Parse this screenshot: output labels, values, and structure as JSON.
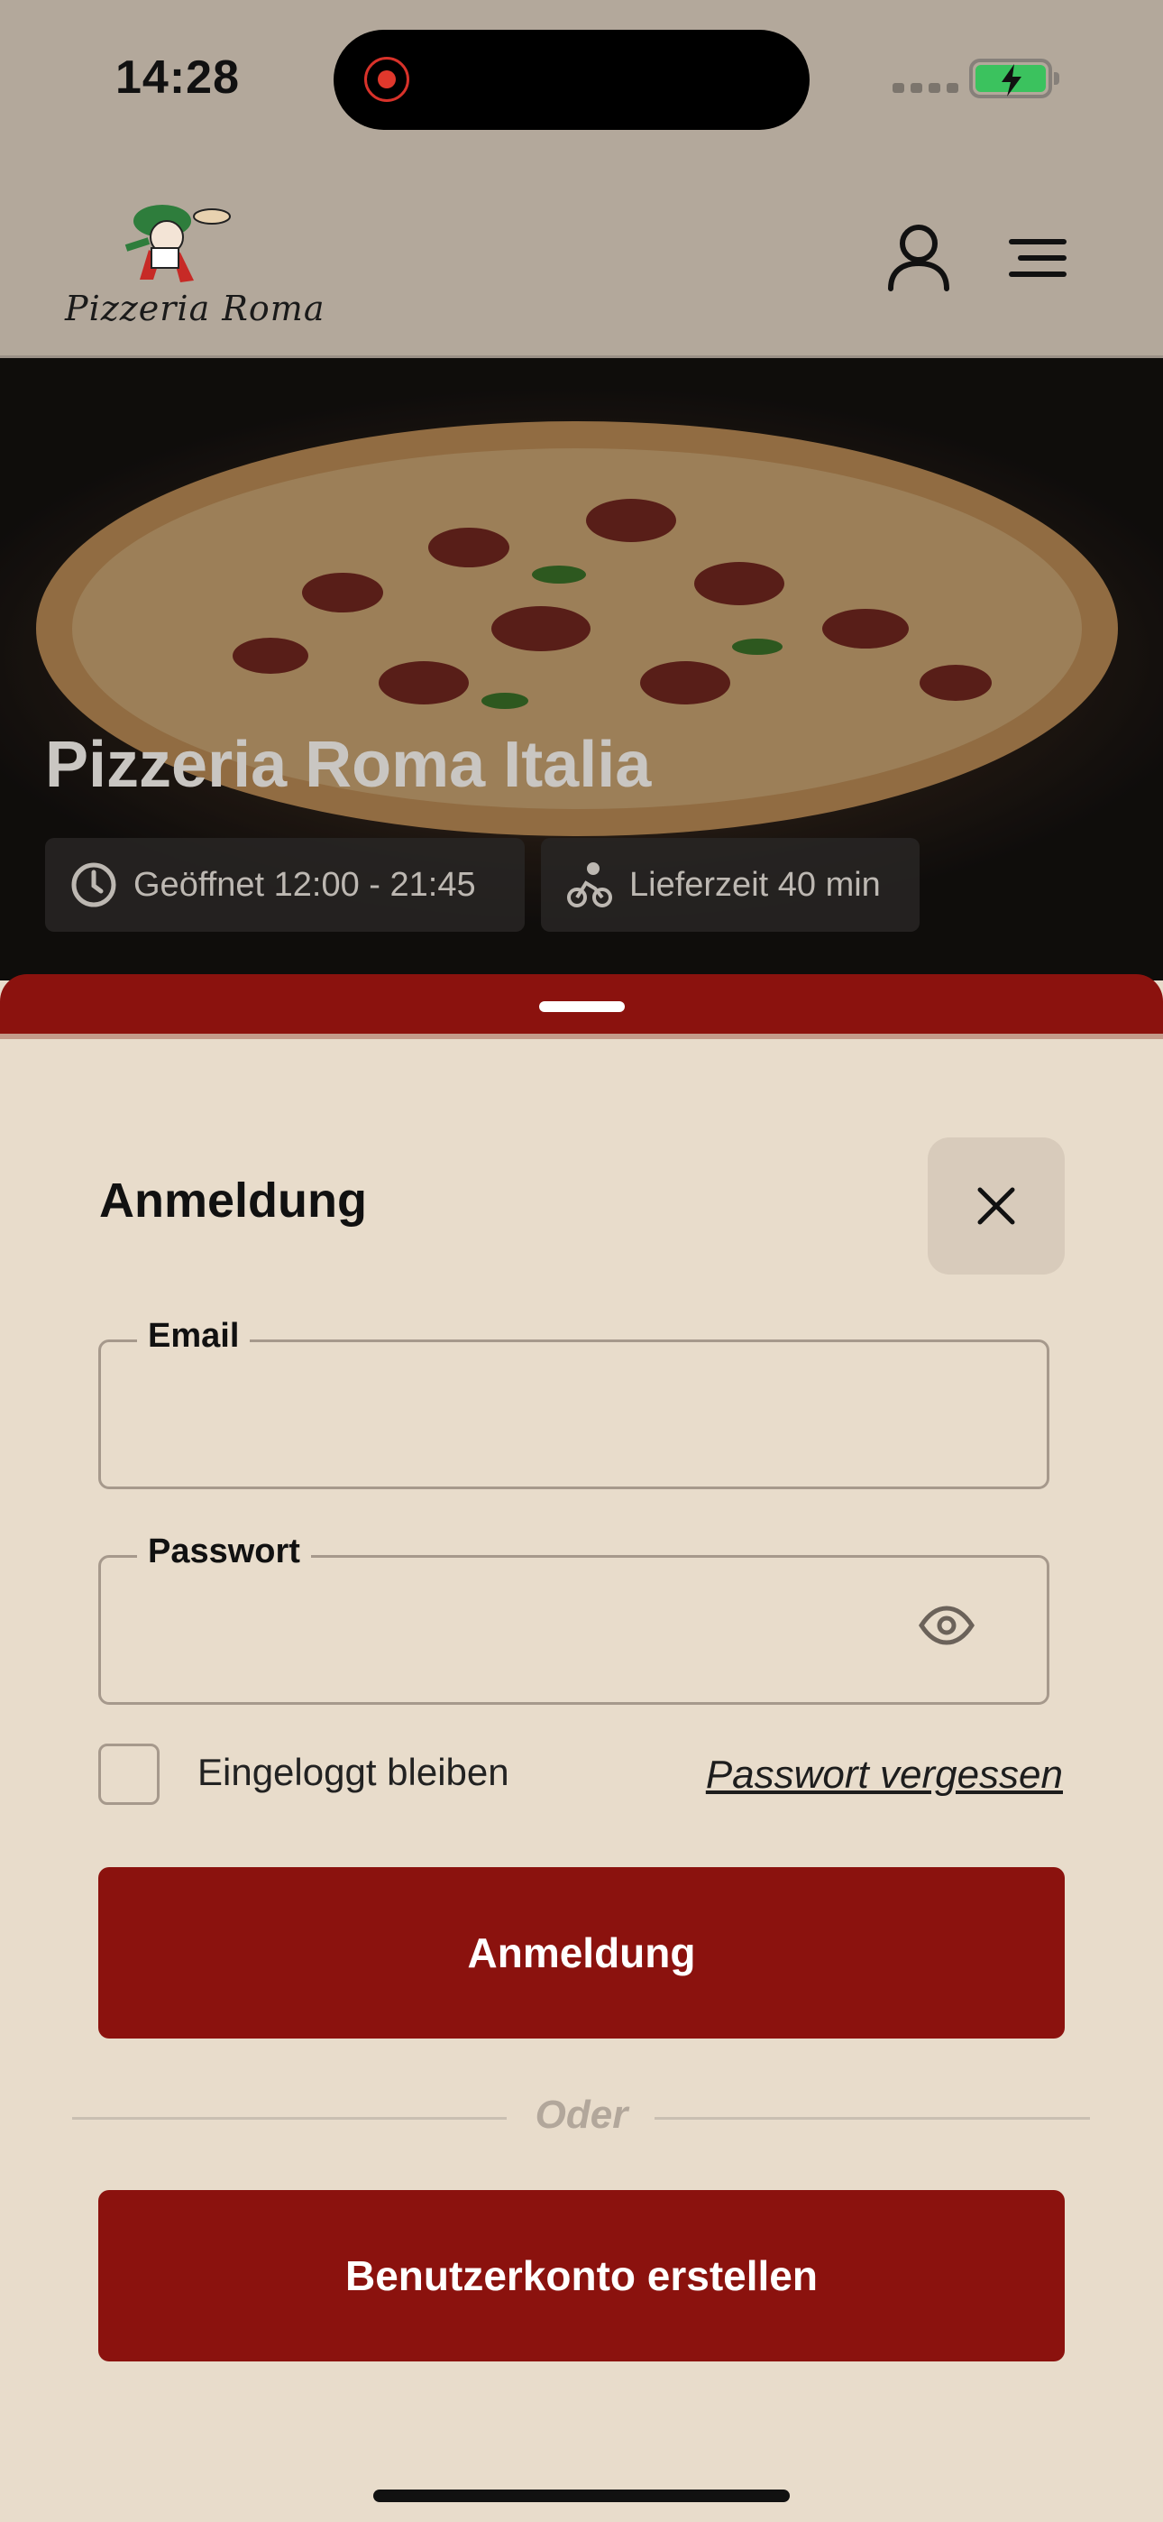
{
  "status": {
    "time": "14:28"
  },
  "header": {
    "logo_text": "Pizzeria Roma"
  },
  "hero": {
    "title": "Pizzeria Roma Italia",
    "opening_hours": "Geöffnet 12:00 - 21:45",
    "delivery_time": "Lieferzeit 40 min"
  },
  "login": {
    "title": "Anmeldung",
    "email_label": "Email",
    "email_value": "",
    "password_label": "Passwort",
    "password_value": "",
    "remember_label": "Eingeloggt bleiben",
    "forgot_label": "Passwort vergessen",
    "submit_label": "Anmeldung",
    "or_label": "Oder",
    "register_label": "Benutzerkonto erstellen"
  },
  "colors": {
    "brand": "#8b120e",
    "sheet_bg": "#e8dccb",
    "header_bg": "#b3a89b"
  }
}
